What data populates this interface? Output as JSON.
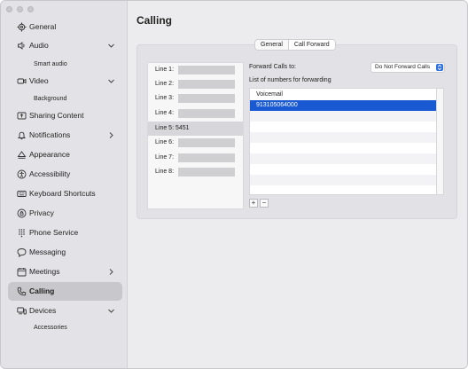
{
  "window": {
    "title": "Calling"
  },
  "sidebar": {
    "items": [
      {
        "label": "General",
        "icon": "gear-icon",
        "chevron": ""
      },
      {
        "label": "Audio",
        "icon": "speaker-icon",
        "chevron": "down"
      },
      {
        "label": "Smart audio",
        "sub": true
      },
      {
        "label": "Video",
        "icon": "video-camera-icon",
        "chevron": "down"
      },
      {
        "label": "Background",
        "sub": true
      },
      {
        "label": "Sharing Content",
        "icon": "share-screen-icon",
        "chevron": ""
      },
      {
        "label": "Notifications",
        "icon": "bell-icon",
        "chevron": "right"
      },
      {
        "label": "Appearance",
        "icon": "appearance-icon",
        "chevron": ""
      },
      {
        "label": "Accessibility",
        "icon": "accessibility-icon",
        "chevron": ""
      },
      {
        "label": "Keyboard Shortcuts",
        "icon": "keyboard-icon",
        "chevron": ""
      },
      {
        "label": "Privacy",
        "icon": "privacy-icon",
        "chevron": ""
      },
      {
        "label": "Phone Service",
        "icon": "dialpad-icon",
        "chevron": ""
      },
      {
        "label": "Messaging",
        "icon": "chat-bubble-icon",
        "chevron": ""
      },
      {
        "label": "Meetings",
        "icon": "calendar-icon",
        "chevron": "right"
      },
      {
        "label": "Calling",
        "icon": "phone-icon",
        "chevron": "",
        "active": true
      },
      {
        "label": "Devices",
        "icon": "devices-icon",
        "chevron": "down"
      },
      {
        "label": "Accessories",
        "sub": true
      }
    ]
  },
  "main": {
    "title": "Calling",
    "tabs": [
      {
        "label": "General"
      },
      {
        "label": "Call Forward",
        "selected": true
      }
    ],
    "lines": [
      {
        "label": "Line 1:",
        "value": "",
        "redacted": true
      },
      {
        "label": "Line 2:",
        "value": "",
        "redacted": true
      },
      {
        "label": "Line 3:",
        "value": "",
        "redacted": true
      },
      {
        "label": "Line 4:",
        "value": "",
        "redacted": true
      },
      {
        "label": "Line 5: 5451",
        "value": "",
        "redacted": false,
        "selected": true
      },
      {
        "label": "Line 6:",
        "value": "",
        "redacted": true
      },
      {
        "label": "Line 7:",
        "value": "",
        "redacted": true
      },
      {
        "label": "Line 8:",
        "value": "",
        "redacted": true
      }
    ],
    "forward_label": "Forward Calls to:",
    "forward_dropdown": "Do Not Forward Calls",
    "list_label": "List of numbers for forwarding",
    "numbers": [
      {
        "label": "Voicemail"
      },
      {
        "label": "913105064000",
        "selected": true
      }
    ],
    "add_label": "+",
    "remove_label": "−"
  },
  "colors": {
    "accent": "#1959d1",
    "sidebar_bg": "#e3e3e7",
    "main_bg": "#ececee"
  }
}
